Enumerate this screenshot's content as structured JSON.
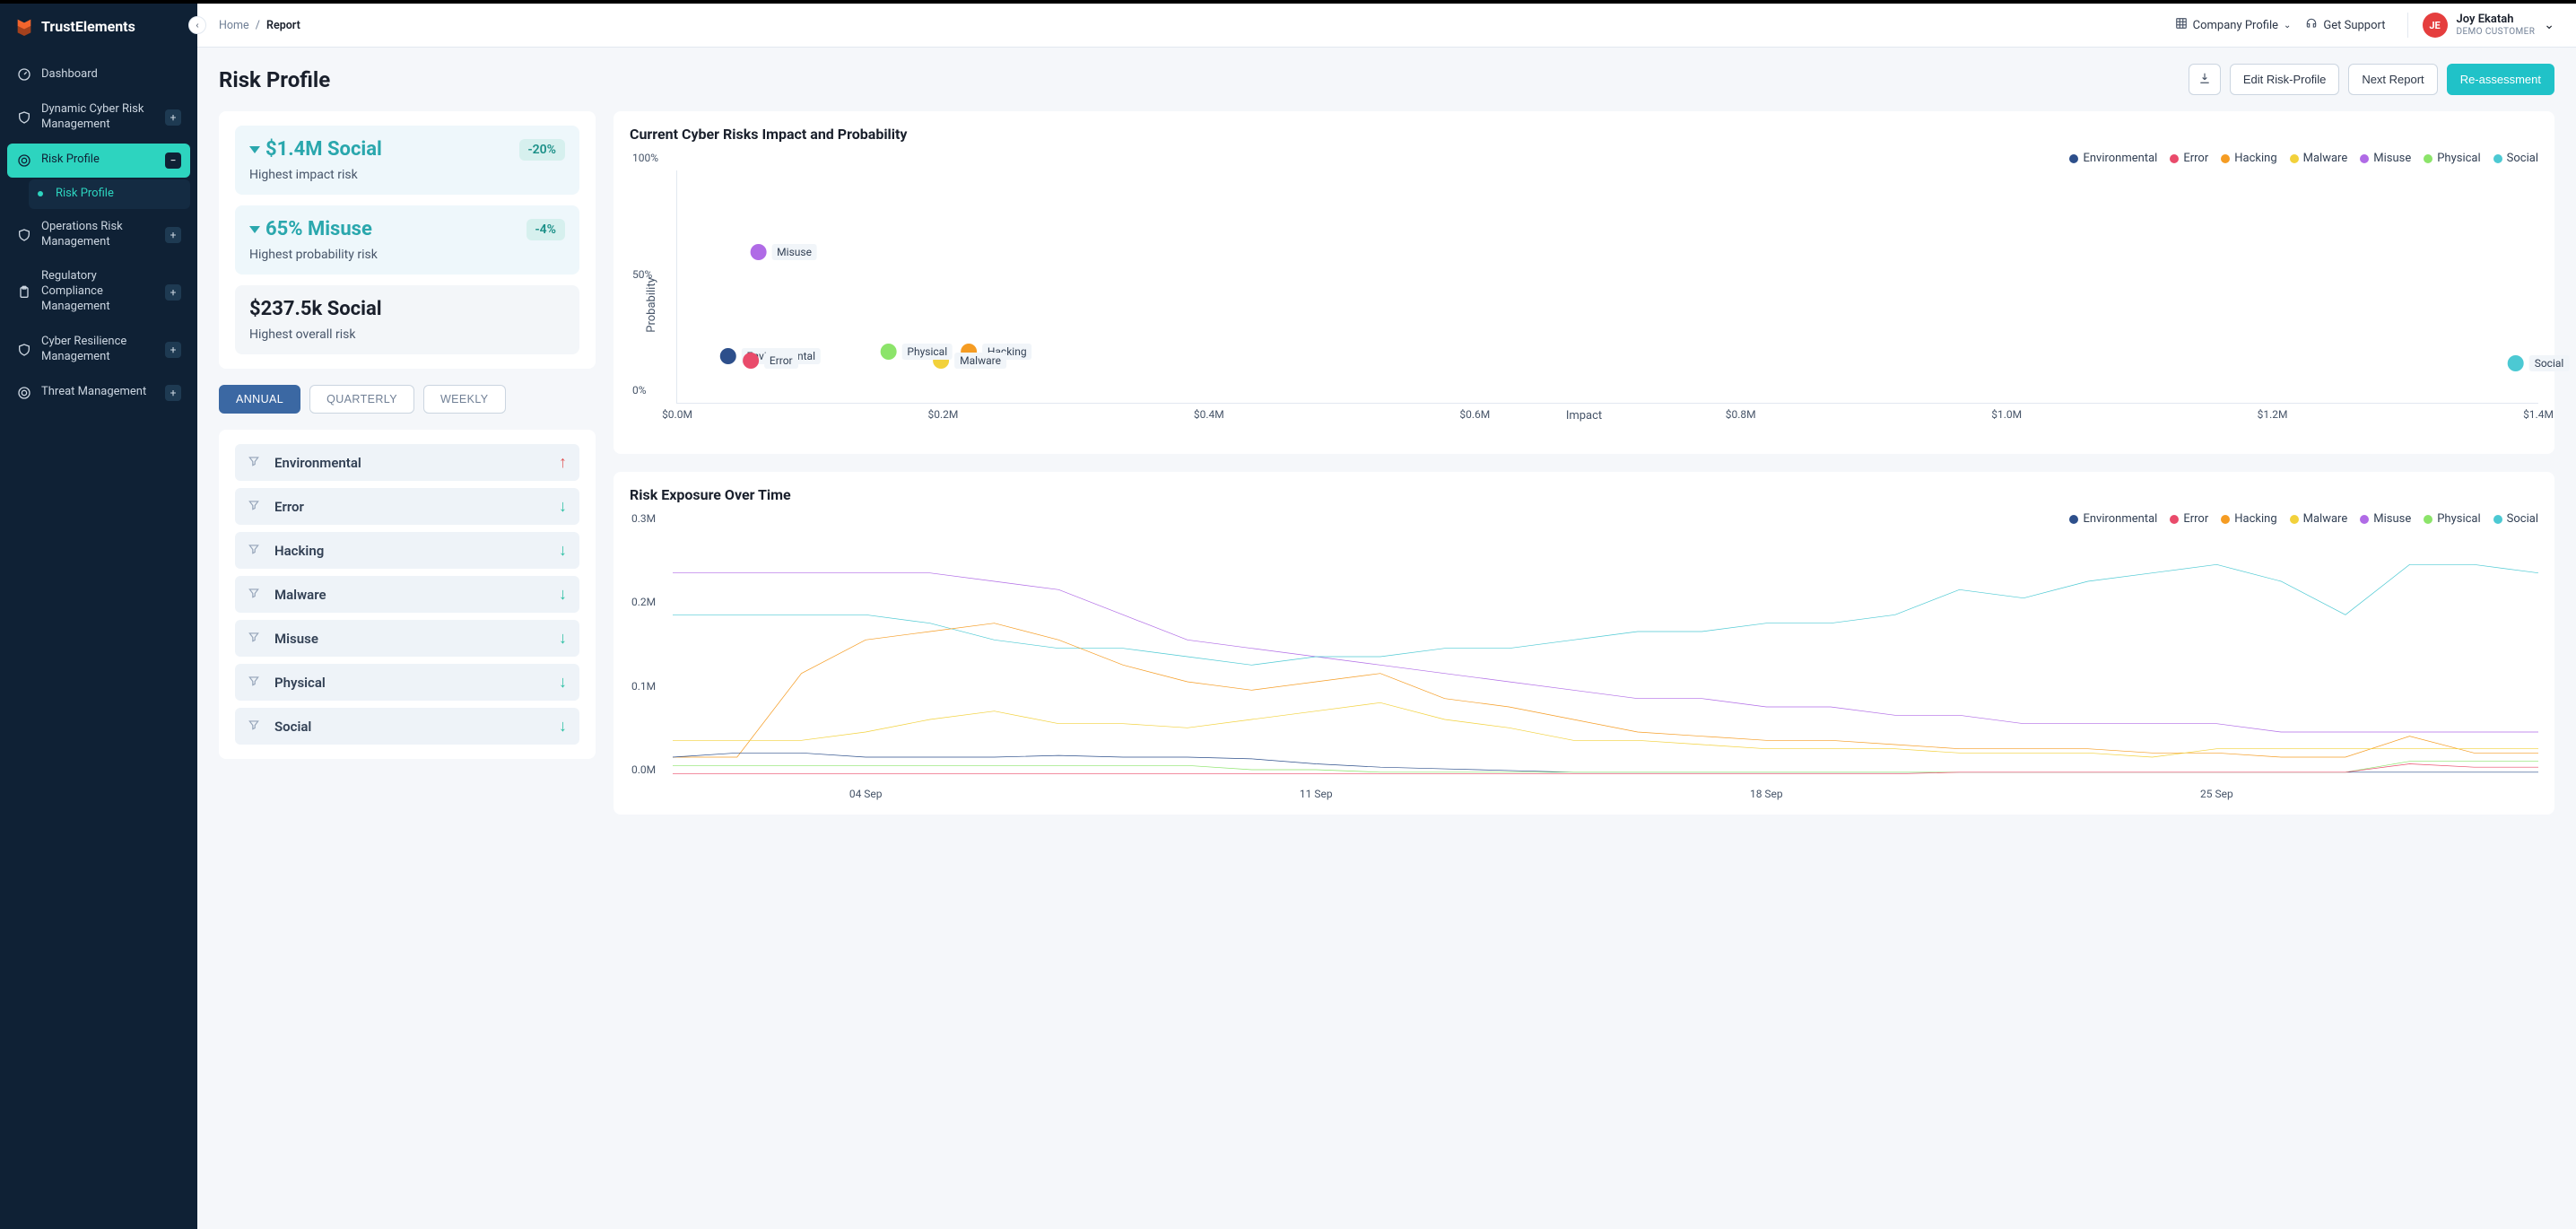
{
  "brand": "TrustElements",
  "sidebar": {
    "items": [
      {
        "label": "Dashboard",
        "icon": "gauge-icon",
        "expandable": false
      },
      {
        "label": "Dynamic Cyber Risk Management",
        "icon": "shield-icon",
        "expandable": true
      },
      {
        "label": "Risk Profile",
        "icon": "target-icon",
        "expandable": true,
        "active": true,
        "sub": [
          {
            "label": "Risk Profile",
            "active": true
          }
        ]
      },
      {
        "label": "Operations Risk Management",
        "icon": "shield-icon",
        "expandable": true
      },
      {
        "label": "Regulatory Compliance Management",
        "icon": "clipboard-icon",
        "expandable": true
      },
      {
        "label": "Cyber Resilience Management",
        "icon": "shield-icon",
        "expandable": true
      },
      {
        "label": "Threat Management",
        "icon": "target-icon",
        "expandable": true
      }
    ]
  },
  "breadcrumb": {
    "home": "Home",
    "current": "Report"
  },
  "topbar": {
    "company": "Company Profile",
    "support": "Get Support",
    "user": {
      "initials": "JE",
      "name": "Joy Ekatah",
      "sub": "DEMO CUSTOMER"
    }
  },
  "page_title": "Risk Profile",
  "actions": {
    "edit": "Edit Risk-Profile",
    "next": "Next Report",
    "reassess": "Re-assessment"
  },
  "kpis": [
    {
      "value": "$1.4M Social",
      "delta": "-20%",
      "sub": "Highest impact risk",
      "tinted": true,
      "caret": true
    },
    {
      "value": "65% Misuse",
      "delta": "-4%",
      "sub": "Highest probability risk",
      "tinted": true,
      "caret": true
    },
    {
      "value": "$237.5k Social",
      "delta": "",
      "sub": "Highest overall risk",
      "tinted": false,
      "caret": false
    }
  ],
  "tabs": [
    "ANNUAL",
    "QUARTERLY",
    "WEEKLY"
  ],
  "active_tab": 0,
  "risks": [
    {
      "name": "Environmental",
      "trend": "up"
    },
    {
      "name": "Error",
      "trend": "down"
    },
    {
      "name": "Hacking",
      "trend": "down"
    },
    {
      "name": "Malware",
      "trend": "down"
    },
    {
      "name": "Misuse",
      "trend": "down"
    },
    {
      "name": "Physical",
      "trend": "down"
    },
    {
      "name": "Social",
      "trend": "down"
    }
  ],
  "series_colors": {
    "Environmental": "#2d4f8b",
    "Error": "#e94b6b",
    "Hacking": "#f59c23",
    "Malware": "#f2d13b",
    "Misuse": "#b06be6",
    "Physical": "#8ce46a",
    "Social": "#4cc9d3"
  },
  "chart_data": [
    {
      "id": "impact_probability",
      "type": "scatter",
      "title": "Current Cyber Risks Impact and Probability",
      "xlabel": "Impact",
      "ylabel": "Probability",
      "xlim_m": [
        0.0,
        1.4
      ],
      "ylim_pct": [
        0,
        100
      ],
      "x_ticks_m": [
        0.0,
        0.2,
        0.4,
        0.6,
        0.8,
        1.0,
        1.2,
        1.4
      ],
      "y_ticks_pct": [
        0,
        50,
        100
      ],
      "points": [
        {
          "name": "Environmental",
          "impact_m": 0.07,
          "probability_pct": 20
        },
        {
          "name": "Error",
          "impact_m": 0.07,
          "probability_pct": 18
        },
        {
          "name": "Hacking",
          "impact_m": 0.24,
          "probability_pct": 22
        },
        {
          "name": "Malware",
          "impact_m": 0.22,
          "probability_pct": 18
        },
        {
          "name": "Misuse",
          "impact_m": 0.08,
          "probability_pct": 65
        },
        {
          "name": "Physical",
          "impact_m": 0.18,
          "probability_pct": 22
        },
        {
          "name": "Social",
          "impact_m": 1.4,
          "probability_pct": 17
        }
      ]
    },
    {
      "id": "exposure_over_time",
      "type": "line",
      "title": "Risk Exposure Over Time",
      "xlabel": "",
      "ylabel": "",
      "ylim_m": [
        0.0,
        0.3
      ],
      "y_ticks_m": [
        0.0,
        0.1,
        0.2,
        0.3
      ],
      "x_ticks": [
        "04 Sep",
        "11 Sep",
        "18 Sep",
        "25 Sep"
      ],
      "n_days": 30,
      "series": [
        {
          "name": "Misuse",
          "values_m": [
            0.25,
            0.25,
            0.25,
            0.25,
            0.25,
            0.24,
            0.23,
            0.2,
            0.17,
            0.16,
            0.15,
            0.14,
            0.13,
            0.12,
            0.11,
            0.1,
            0.1,
            0.09,
            0.09,
            0.08,
            0.08,
            0.07,
            0.07,
            0.07,
            0.07,
            0.06,
            0.06,
            0.06,
            0.06,
            0.06
          ]
        },
        {
          "name": "Social",
          "values_m": [
            0.2,
            0.2,
            0.2,
            0.2,
            0.19,
            0.17,
            0.16,
            0.16,
            0.15,
            0.14,
            0.15,
            0.15,
            0.16,
            0.16,
            0.17,
            0.18,
            0.18,
            0.19,
            0.19,
            0.2,
            0.23,
            0.22,
            0.24,
            0.25,
            0.26,
            0.24,
            0.2,
            0.26,
            0.26,
            0.25
          ]
        },
        {
          "name": "Hacking",
          "values_m": [
            0.03,
            0.03,
            0.13,
            0.17,
            0.18,
            0.19,
            0.17,
            0.14,
            0.12,
            0.11,
            0.12,
            0.13,
            0.1,
            0.09,
            0.075,
            0.06,
            0.055,
            0.05,
            0.05,
            0.045,
            0.04,
            0.04,
            0.04,
            0.035,
            0.035,
            0.03,
            0.03,
            0.055,
            0.035,
            0.035
          ]
        },
        {
          "name": "Malware",
          "values_m": [
            0.05,
            0.05,
            0.05,
            0.06,
            0.075,
            0.085,
            0.07,
            0.07,
            0.065,
            0.075,
            0.085,
            0.095,
            0.075,
            0.065,
            0.05,
            0.05,
            0.045,
            0.04,
            0.04,
            0.04,
            0.035,
            0.035,
            0.035,
            0.03,
            0.04,
            0.04,
            0.04,
            0.04,
            0.04,
            0.04
          ]
        },
        {
          "name": "Environmental",
          "values_m": [
            0.03,
            0.035,
            0.035,
            0.03,
            0.03,
            0.03,
            0.032,
            0.03,
            0.03,
            0.028,
            0.022,
            0.018,
            0.016,
            0.014,
            0.012,
            0.012,
            0.012,
            0.012,
            0.012,
            0.012,
            0.012,
            0.012,
            0.012,
            0.012,
            0.012,
            0.012,
            0.012,
            0.012,
            0.012,
            0.012
          ]
        },
        {
          "name": "Physical",
          "values_m": [
            0.02,
            0.02,
            0.02,
            0.02,
            0.02,
            0.02,
            0.02,
            0.02,
            0.02,
            0.015,
            0.015,
            0.012,
            0.012,
            0.012,
            0.012,
            0.012,
            0.012,
            0.012,
            0.012,
            0.012,
            0.012,
            0.012,
            0.012,
            0.012,
            0.012,
            0.012,
            0.012,
            0.025,
            0.025,
            0.025
          ]
        },
        {
          "name": "Error",
          "values_m": [
            0.01,
            0.01,
            0.01,
            0.01,
            0.01,
            0.01,
            0.01,
            0.01,
            0.01,
            0.01,
            0.01,
            0.01,
            0.01,
            0.01,
            0.01,
            0.01,
            0.01,
            0.01,
            0.01,
            0.01,
            0.012,
            0.012,
            0.012,
            0.012,
            0.012,
            0.012,
            0.012,
            0.022,
            0.018,
            0.018
          ]
        }
      ]
    }
  ]
}
